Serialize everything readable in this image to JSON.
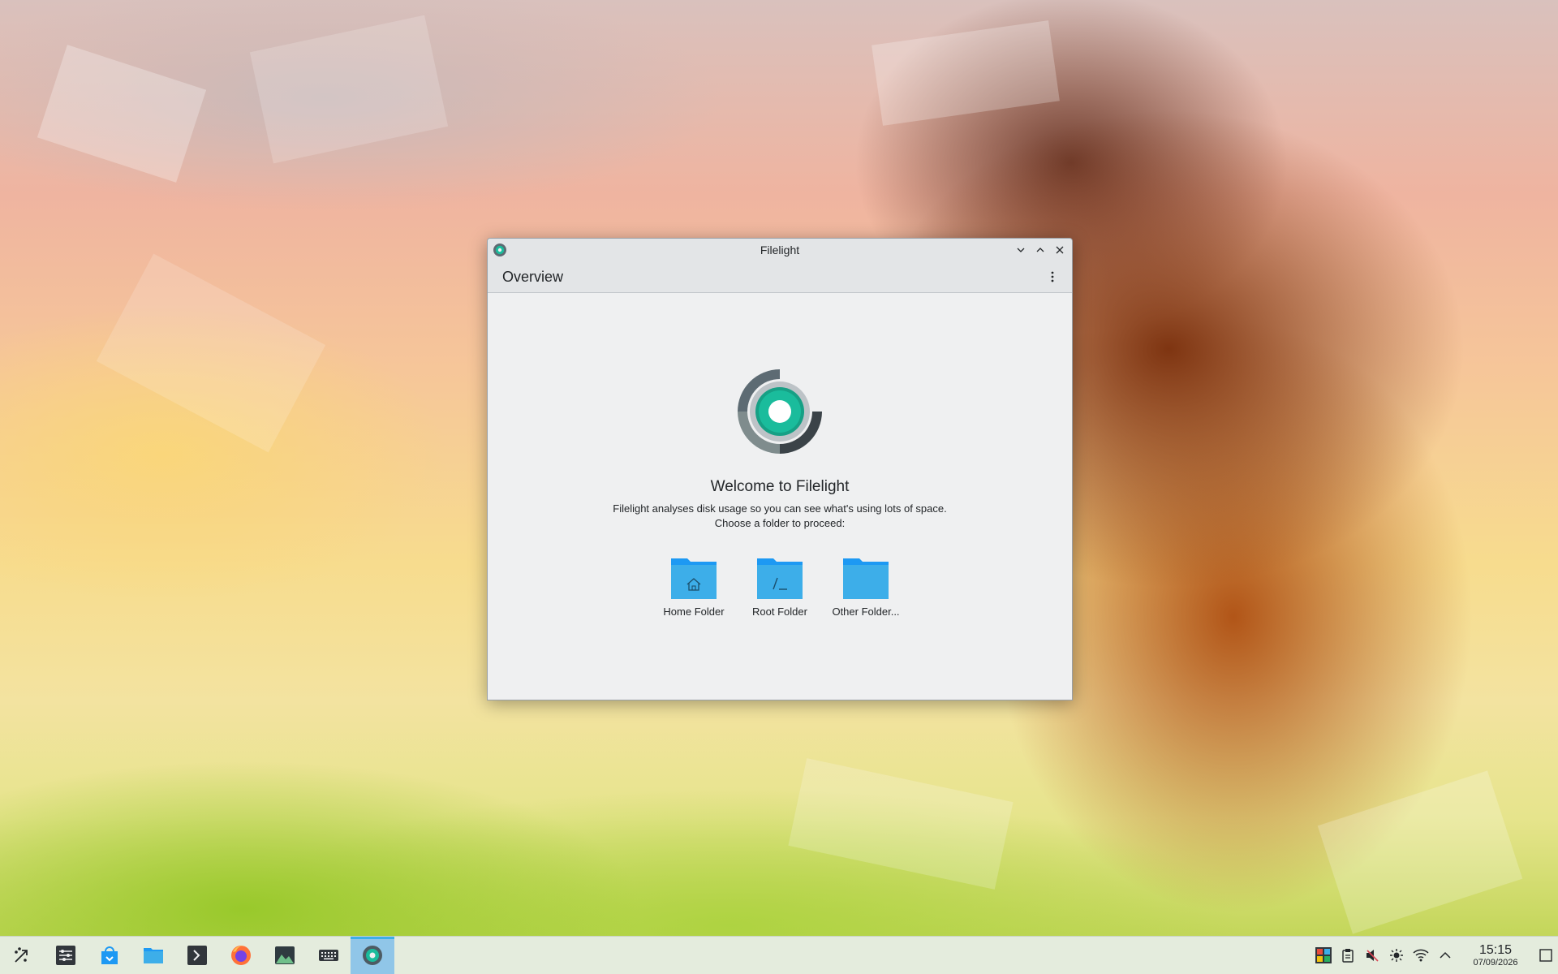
{
  "window": {
    "title": "Filelight",
    "header_title": "Overview"
  },
  "welcome": {
    "title": "Welcome to Filelight",
    "description_line1": "Filelight analyses disk usage so you can see what's using lots of space.",
    "description_line2": "Choose a folder to proceed:"
  },
  "folders": [
    {
      "label": "Home Folder",
      "icon": "home-folder-icon"
    },
    {
      "label": "Root Folder",
      "icon": "root-folder-icon"
    },
    {
      "label": "Other Folder...",
      "icon": "folder-icon"
    }
  ],
  "taskbar": {
    "apps": [
      {
        "name": "application-launcher",
        "icon": "launcher-icon"
      },
      {
        "name": "system-settings",
        "icon": "settings-icon"
      },
      {
        "name": "discover",
        "icon": "store-icon"
      },
      {
        "name": "dolphin",
        "icon": "file-manager-icon"
      },
      {
        "name": "konsole",
        "icon": "terminal-icon"
      },
      {
        "name": "firefox",
        "icon": "firefox-icon"
      },
      {
        "name": "spectacle",
        "icon": "image-icon"
      },
      {
        "name": "keyboard",
        "icon": "keyboard-icon"
      },
      {
        "name": "filelight",
        "icon": "filelight-icon",
        "active": true
      }
    ],
    "clock": {
      "time": "15:15",
      "date": "07/09/2026"
    }
  },
  "colors": {
    "folder_blue": "#3daee9",
    "folder_dark": "#1d99f3",
    "accent": "#3daee9",
    "filelight_green": "#1abc9c"
  }
}
